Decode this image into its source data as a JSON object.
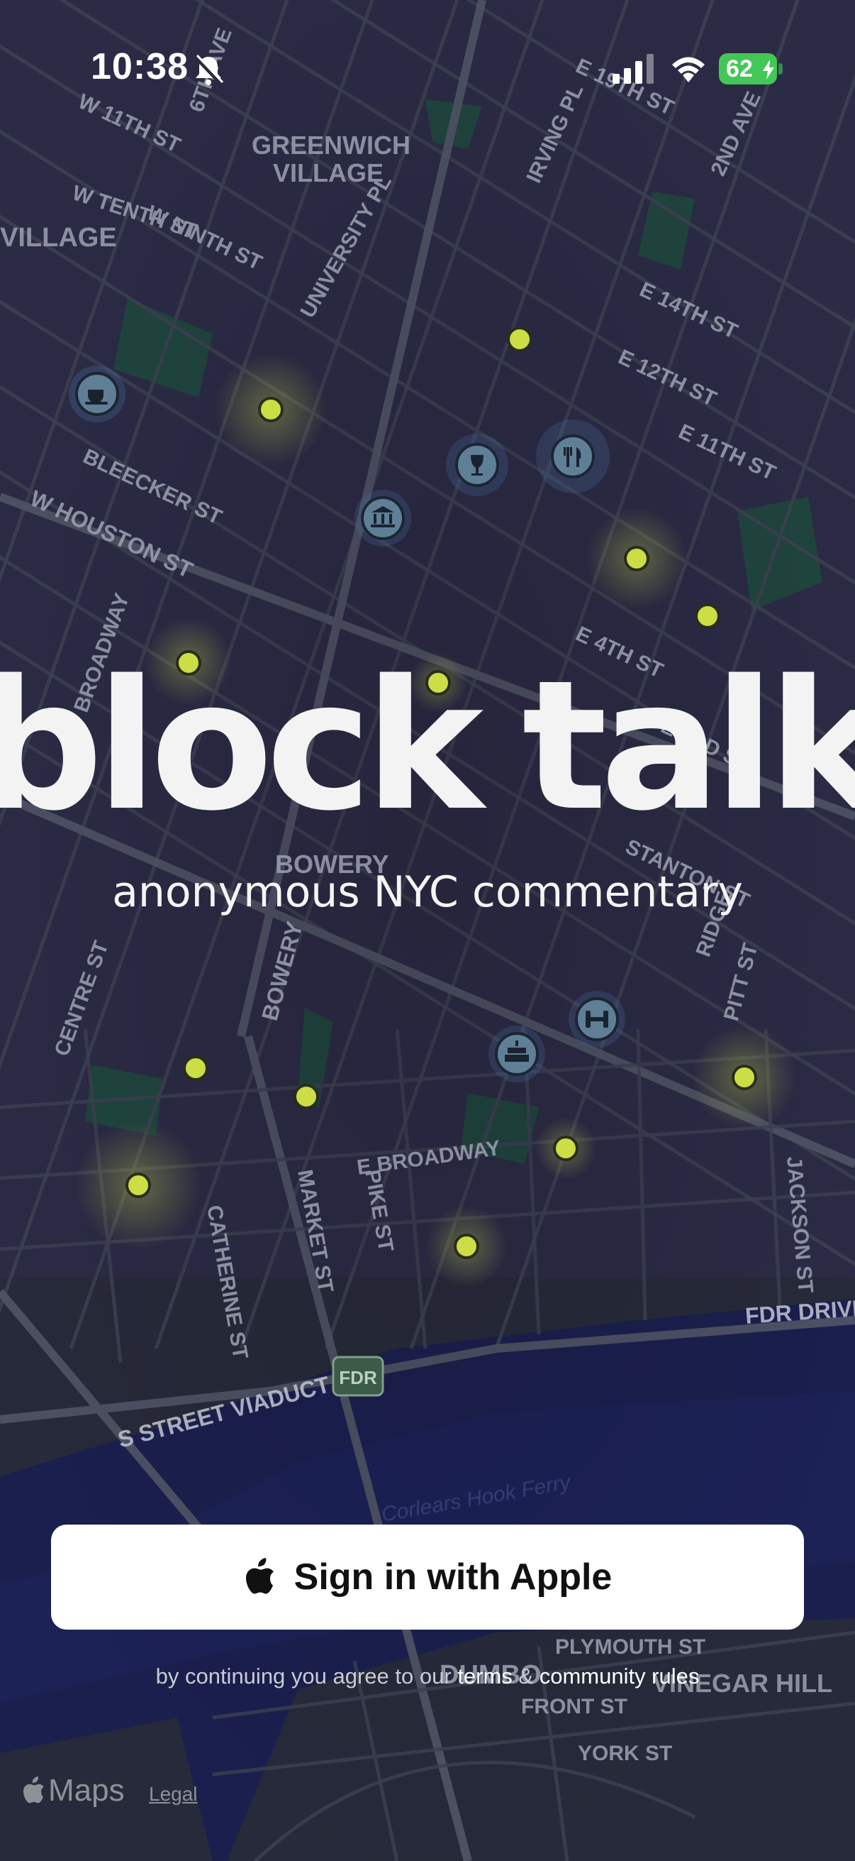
{
  "status_bar": {
    "time": "10:38",
    "battery": "62",
    "icons": [
      "bell-slash-icon",
      "cellular-signal-icon",
      "wifi-icon",
      "battery-charging-icon"
    ]
  },
  "map": {
    "street_labels": [
      "GREENWICH",
      "VILLAGE",
      "VILLAGE",
      "W 11TH ST",
      "W TENTH ST",
      "W NINTH ST",
      "6TH AVE",
      "UNIVERSITY PL",
      "IRVING PL",
      "E 19TH ST",
      "2ND AVE",
      "E 14TH ST",
      "E 12TH ST",
      "E 11TH ST",
      "BLEECKER ST",
      "W HOUSTON ST",
      "W BROADWAY",
      "E 4TH ST",
      "E 3RD ST",
      "STANTON ST",
      "BOWERY",
      "BOWERY",
      "RIDGE",
      "PITT ST",
      "CENTRE ST",
      "E BROADWAY",
      "MARKET ST",
      "PIKE ST",
      "CATHERINE ST",
      "JACKSON ST",
      "FDR DRIVE",
      "FDR",
      "S STREET VIADUCT",
      "PLYMOUTH ST",
      "DUMBO",
      "FRONT ST",
      "YORK ST",
      "VINEGAR HILL",
      "Corlears Hook Ferry"
    ],
    "place_icons": [
      "coffee-icon",
      "wine-glass-icon",
      "restaurant-icon",
      "museum-icon",
      "dumbbell-icon",
      "cake-icon"
    ],
    "colors": {
      "water": "#1b1f4e",
      "land": "#262a3a",
      "block": "#2c2b45",
      "road": "#4a4f60",
      "park": "#1f4a3e",
      "pin": "#d4e44a"
    }
  },
  "brand": {
    "word_left": "block",
    "word_right": "talk",
    "tagline": "anonymous NYC commentary",
    "accent_color": "#dfee4a"
  },
  "signin": {
    "button_label": "Sign in with Apple",
    "legal_prefix": "by continuing you agree to our ",
    "terms": "terms",
    "amp": " & ",
    "community_rules": "community rules"
  },
  "attribution": {
    "maps_label": "Maps",
    "legal_link": "Legal"
  }
}
